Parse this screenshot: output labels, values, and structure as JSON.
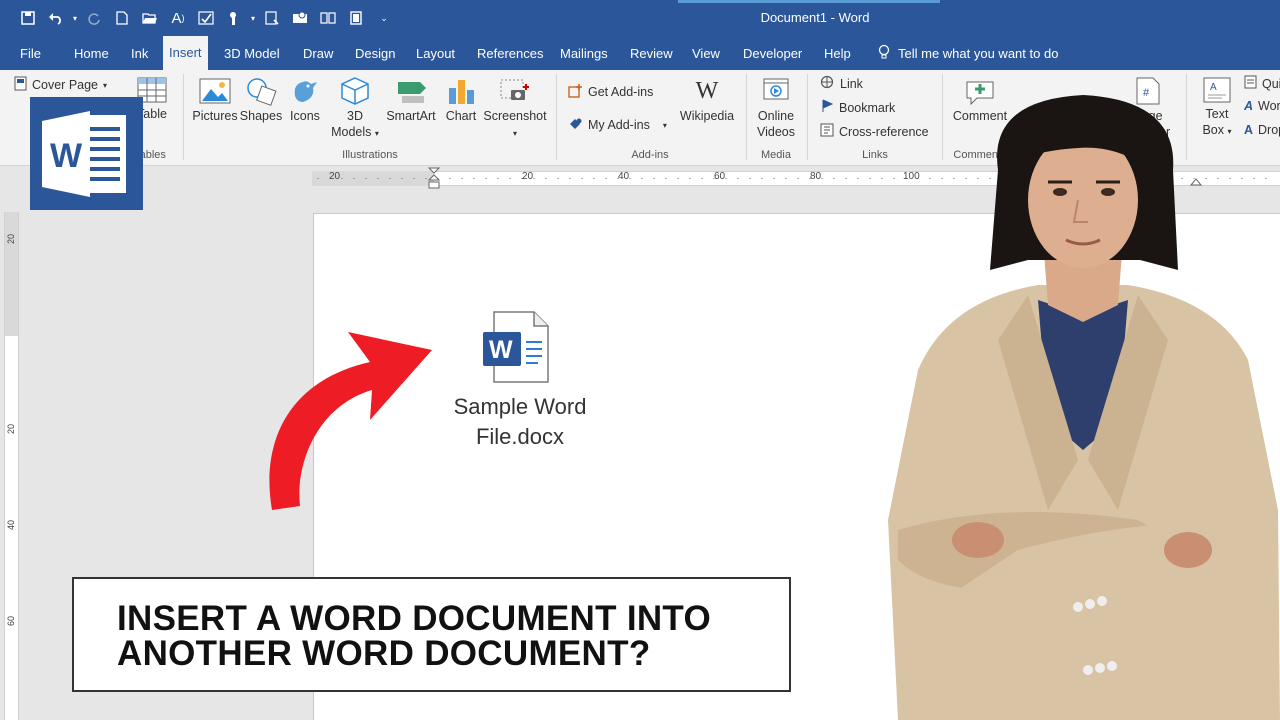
{
  "title_bar": {
    "title": "Document1  -  Word"
  },
  "tabs": [
    "File",
    "Home",
    "Ink",
    "Insert",
    "3D Model",
    "Draw",
    "Design",
    "Layout",
    "References",
    "Mailings",
    "Review",
    "View",
    "Developer",
    "Help"
  ],
  "active_tab": "Insert",
  "tell_me": "Tell me what you want to do",
  "ribbon": {
    "pages": {
      "cover_page": "Cover Page"
    },
    "tables": {
      "table": "Table",
      "group": "Tables"
    },
    "illustrations": {
      "pictures": "Pictures",
      "shapes": "Shapes",
      "icons": "Icons",
      "models_3d_line1": "3D",
      "models_3d_line2": "Models",
      "smartart": "SmartArt",
      "chart": "Chart",
      "screenshot": "Screenshot",
      "group": "Illustrations"
    },
    "addins": {
      "get_addins": "Get Add-ins",
      "my_addins": "My Add-ins",
      "wikipedia": "Wikipedia",
      "group": "Add-ins"
    },
    "media": {
      "online_videos_line1": "Online",
      "online_videos_line2": "Videos",
      "group": "Media"
    },
    "links": {
      "link": "Link",
      "bookmark": "Bookmark",
      "cross_reference": "Cross-reference",
      "group": "Links"
    },
    "comments": {
      "comment": "Comment",
      "group": "Comments"
    },
    "header_footer": {
      "page_number_line1": "Page",
      "page_number_line2": "Number"
    },
    "text": {
      "text_box_line1": "Text",
      "text_box_line2": "Box",
      "quick_parts": "Quick Parts",
      "wordart": "WordArt",
      "drop_cap": "Drop Cap"
    }
  },
  "ruler": {
    "labels": [
      "20",
      "20",
      "40",
      "60",
      "80",
      "100"
    ]
  },
  "vertical_ruler": {
    "labels": [
      "20",
      "20",
      "40",
      "60"
    ]
  },
  "document": {
    "file_name_line1": "Sample Word",
    "file_name_line2": "File.docx"
  },
  "caption": {
    "line1": "INSERT A WORD DOCUMENT INTO",
    "line2": "ANOTHER WORD DOCUMENT?"
  },
  "colors": {
    "word_blue": "#2b579a",
    "arrow_red": "#ee1c24"
  },
  "icons": [
    "save-icon",
    "undo-icon",
    "redo-icon",
    "new-document-icon",
    "open-icon",
    "font-icon",
    "spelling-icon",
    "touch-mode-icon",
    "lightbulb-icon",
    "word-logo-icon",
    "word-file-icon",
    "arrow-icon"
  ]
}
